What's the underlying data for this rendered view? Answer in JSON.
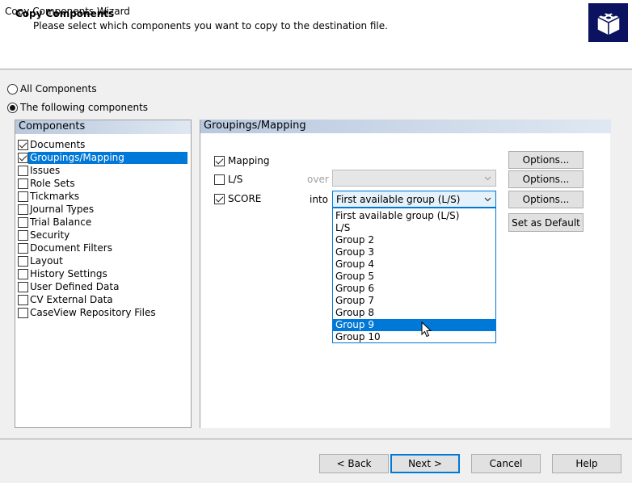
{
  "window": {
    "title": "Copy Components Wizard"
  },
  "header": {
    "title": "Copy Components",
    "subtitle": "Please select which components you want to copy to the destination file."
  },
  "selection_mode": {
    "options": [
      {
        "label": "All Components",
        "selected": false
      },
      {
        "label": "The following components",
        "selected": true
      }
    ]
  },
  "components": {
    "header": "Components",
    "items": [
      {
        "label": "Documents",
        "checked": true
      },
      {
        "label": "Groupings/Mapping",
        "checked": true
      },
      {
        "label": "Issues",
        "checked": false
      },
      {
        "label": "Role Sets",
        "checked": false
      },
      {
        "label": "Tickmarks",
        "checked": false
      },
      {
        "label": "Journal Types",
        "checked": false
      },
      {
        "label": "Trial Balance",
        "checked": false
      },
      {
        "label": "Security",
        "checked": false
      },
      {
        "label": "Document Filters",
        "checked": false
      },
      {
        "label": "Layout",
        "checked": false
      },
      {
        "label": "History Settings",
        "checked": false
      },
      {
        "label": "User Defined Data",
        "checked": false
      },
      {
        "label": "CV External Data",
        "checked": false
      },
      {
        "label": "CaseView Repository Files",
        "checked": false
      }
    ],
    "selected_index": 1
  },
  "groupings": {
    "header": "Groupings/Mapping",
    "mapping": {
      "label": "Mapping",
      "checked": true
    },
    "ls": {
      "label": "L/S",
      "checked": false,
      "connector": "over",
      "combo_value": ""
    },
    "score": {
      "label": "SCORE",
      "checked": true,
      "connector": "into",
      "combo_value": "First available group (L/S)"
    },
    "dropdown_options": [
      "First available group (L/S)",
      "L/S",
      "Group 2",
      "Group 3",
      "Group 4",
      "Group 5",
      "Group 6",
      "Group 7",
      "Group 8",
      "Group 9",
      "Group 10"
    ],
    "highlighted_option": "Group 9",
    "options_button_label": "Options...",
    "set_default_label": "Set as Default"
  },
  "footer": {
    "back": "< Back",
    "next": "Next >",
    "cancel": "Cancel",
    "help": "Help"
  }
}
